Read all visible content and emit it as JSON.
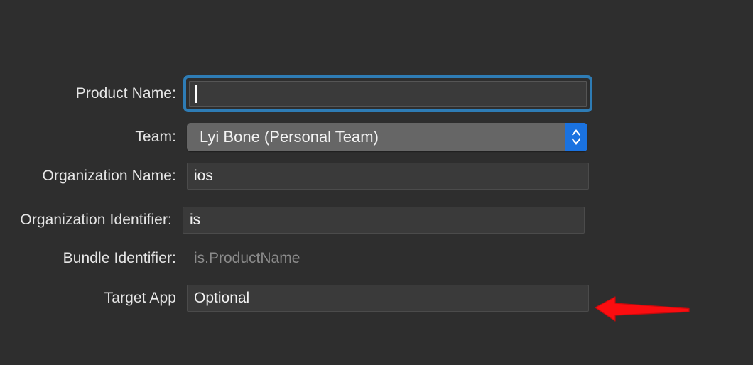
{
  "window": {
    "background_color": "#2e2e2e",
    "accent_color": "#1a72e0",
    "focus_ring_color": "#2e7cb5",
    "annotation_color": "#fb0d10"
  },
  "form": {
    "rows": [
      {
        "label": "Product Name:",
        "control": "text-field-focused",
        "value": "",
        "placeholder": ""
      },
      {
        "label": "Team:",
        "control": "popup-button",
        "value": "Lyi Bone (Personal Team)",
        "stepper_up_icon": "chevron-up-icon",
        "stepper_down_icon": "chevron-down-icon"
      },
      {
        "label": "Organization Name:",
        "control": "text-field",
        "value": "ios",
        "placeholder": ""
      },
      {
        "label": "Organization Identifier:",
        "control": "text-field",
        "value": "is",
        "placeholder": ""
      },
      {
        "label": "Bundle Identifier:",
        "control": "static-text",
        "value": "is.ProductName"
      },
      {
        "label": "Target App",
        "control": "text-field",
        "value": "Optional",
        "placeholder": "Optional"
      }
    ]
  },
  "annotation": {
    "type": "arrow",
    "direction": "left",
    "color": "#fb0d10",
    "points_at": "Target App"
  }
}
